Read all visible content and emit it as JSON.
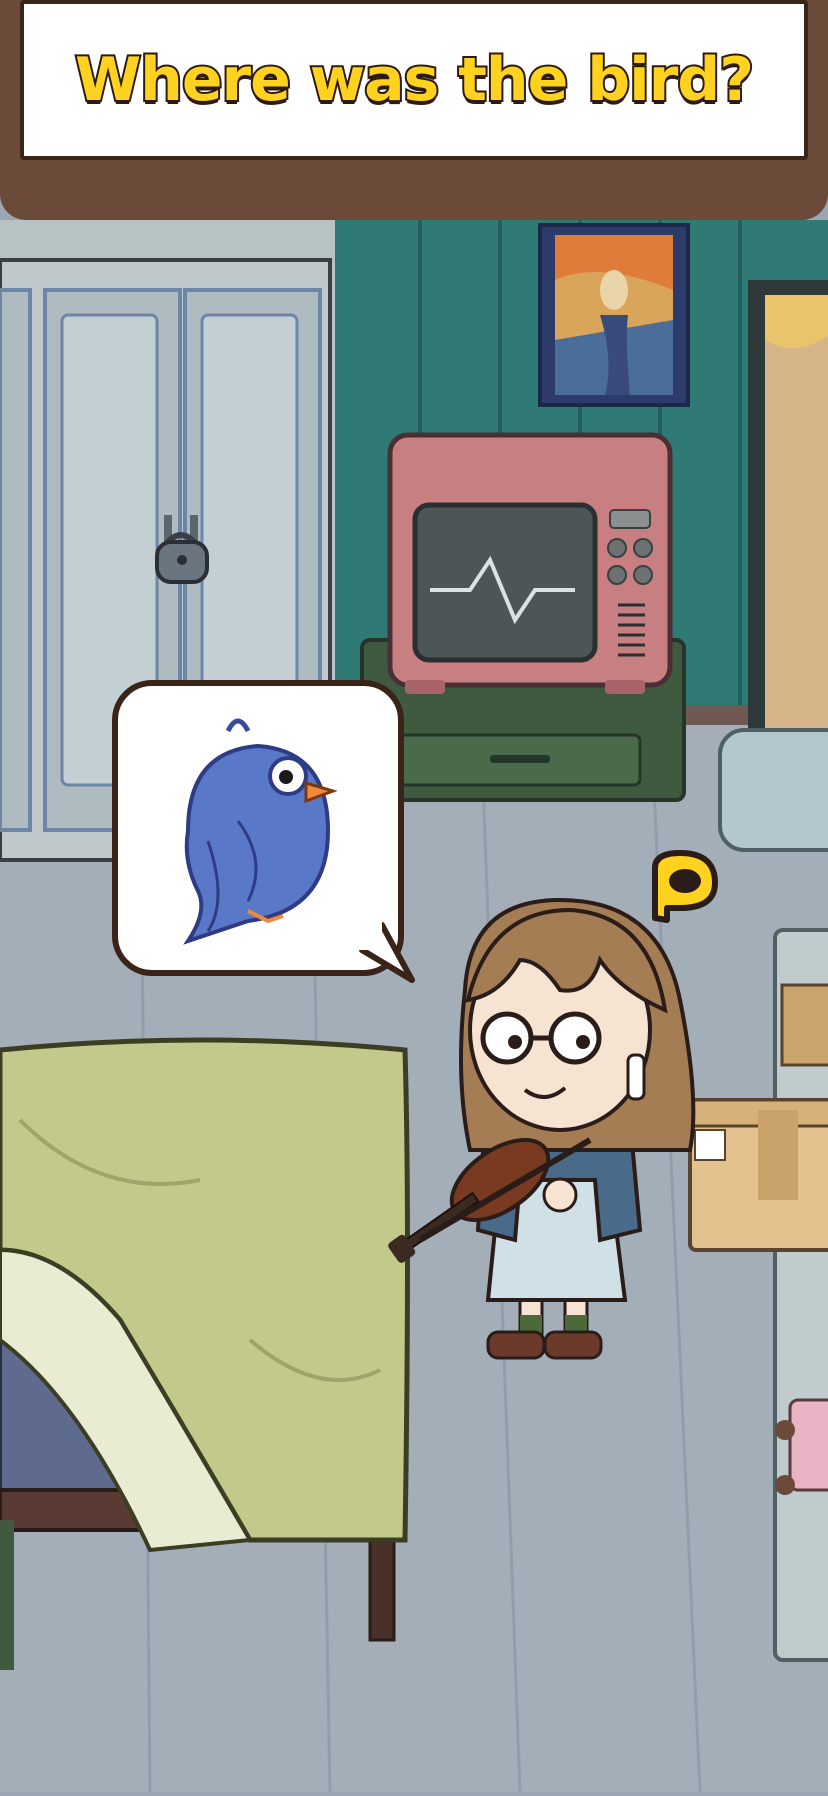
{
  "question": {
    "text": "Where was the bird?"
  },
  "colors": {
    "title_fill": "#ffd21f",
    "title_outline": "#2d1b10",
    "board_frame": "#6b4a3a",
    "wall": "#2f7a74",
    "floor": "#9aa7b2"
  },
  "scene": {
    "objects": [
      "wardrobe-with-padlock",
      "retro-tv",
      "tv-stand",
      "painting",
      "bed-with-green-blanket",
      "girl-with-violin",
      "cardboard-box",
      "shelf",
      "pillow"
    ],
    "speech_bubble_icon": "blue-bird-icon",
    "hint_icon": "yellow-p-icon"
  }
}
